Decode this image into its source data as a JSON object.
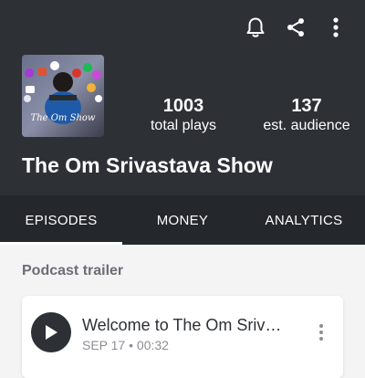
{
  "header": {
    "icons": [
      "bell-icon",
      "share-icon",
      "more-vertical-icon"
    ],
    "cover_art_text": "The Om Srivastava Show",
    "stats": [
      {
        "value": "1003",
        "label": "total plays"
      },
      {
        "value": "137",
        "label": "est. audience"
      }
    ],
    "show_title": "The Om Srivastava Show"
  },
  "tabs": [
    {
      "label": "EPISODES",
      "active": true
    },
    {
      "label": "MONEY",
      "active": false
    },
    {
      "label": "ANALYTICS",
      "active": false
    }
  ],
  "section": {
    "title": "Podcast trailer"
  },
  "episode": {
    "title": "Welcome to The Om Sriv…",
    "date": "SEP 17",
    "separator": "•",
    "duration": "00:32",
    "icons": [
      "play-icon",
      "more-vertical-icon"
    ]
  },
  "colors": {
    "header_bg": "#2d3035",
    "tabs_bg": "#24272b",
    "page_bg": "#f4f4f5",
    "text_primary": "#2d3035",
    "text_muted": "#8b8e93"
  }
}
